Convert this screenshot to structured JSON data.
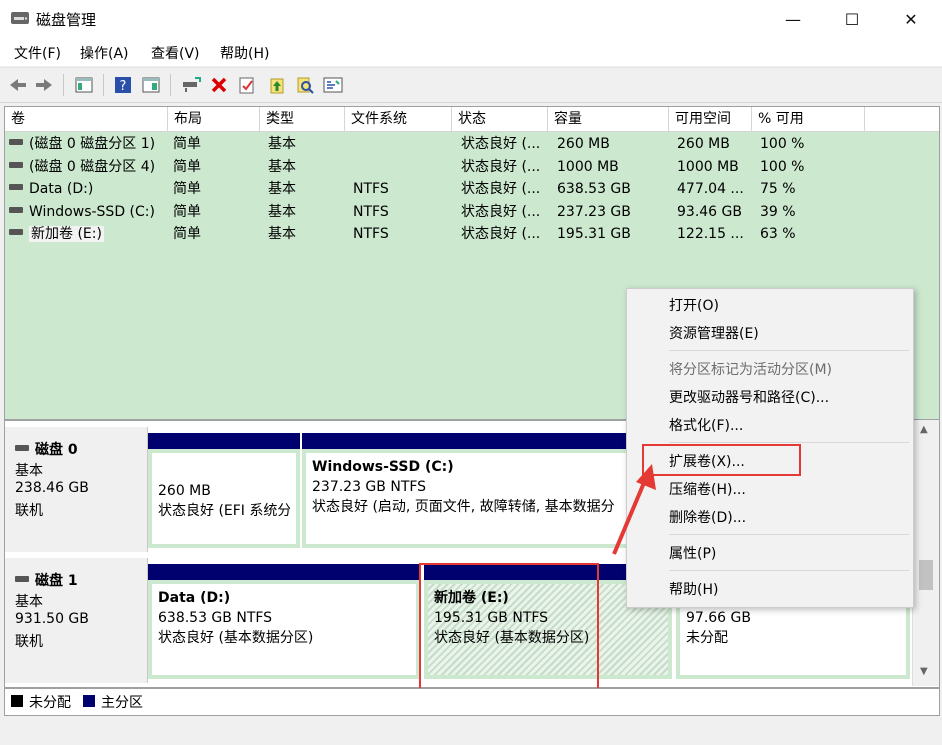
{
  "window": {
    "title": "磁盘管理",
    "minimize": "—",
    "maximize": "☐",
    "close": "✕"
  },
  "menu": [
    "文件(F)",
    "操作(A)",
    "查看(V)",
    "帮助(H)"
  ],
  "toolbar": {
    "icons": [
      "back-icon",
      "forward-icon",
      "console-tree-icon",
      "help-icon",
      "show-pane-icon",
      "connect-icon",
      "delete-icon",
      "check-icon",
      "up-arrow-icon",
      "search-icon",
      "properties-icon"
    ]
  },
  "volume_table": {
    "columns": [
      "卷",
      "布局",
      "类型",
      "文件系统",
      "状态",
      "容量",
      "可用空间",
      "% 可用"
    ],
    "rows": [
      [
        "(磁盘 0 磁盘分区 1)",
        "简单",
        "基本",
        "",
        "状态良好 (...",
        "260 MB",
        "260 MB",
        "100 %"
      ],
      [
        "(磁盘 0 磁盘分区 4)",
        "简单",
        "基本",
        "",
        "状态良好 (...",
        "1000 MB",
        "1000 MB",
        "100 %"
      ],
      [
        "Data (D:)",
        "简单",
        "基本",
        "NTFS",
        "状态良好 (...",
        "638.53 GB",
        "477.04 ...",
        "75 %"
      ],
      [
        "Windows-SSD (C:)",
        "简单",
        "基本",
        "NTFS",
        "状态良好 (...",
        "237.23 GB",
        "93.46 GB",
        "39 %"
      ],
      [
        "新加卷 (E:)",
        "简单",
        "基本",
        "NTFS",
        "状态良好 (...",
        "195.31 GB",
        "122.15 ...",
        "63 %"
      ]
    ]
  },
  "disks": [
    {
      "name": "磁盘 0",
      "type": "基本",
      "size": "238.46 GB",
      "status": "联机",
      "partitions": [
        {
          "title": "",
          "size": "260 MB",
          "status": "状态良好 (EFI 系统分"
        },
        {
          "title": "Windows-SSD  (C:)",
          "size": "237.23 GB NTFS",
          "status": "状态良好 (启动, 页面文件, 故障转储, 基本数据分"
        }
      ]
    },
    {
      "name": "磁盘 1",
      "type": "基本",
      "size": "931.50 GB",
      "status": "联机",
      "partitions": [
        {
          "title": "Data  (D:)",
          "size": "638.53 GB NTFS",
          "status": "状态良好 (基本数据分区)"
        },
        {
          "title": "新加卷  (E:)",
          "size": "195.31 GB NTFS",
          "status": "状态良好 (基本数据分区)"
        },
        {
          "title": "",
          "size": "97.66 GB",
          "status": "未分配"
        }
      ]
    }
  ],
  "legend": {
    "unallocated": "未分配",
    "primary": "主分区"
  },
  "context_menu": {
    "items": [
      "打开(O)",
      "资源管理器(E)",
      "将分区标记为活动分区(M)",
      "更改驱动器号和路径(C)...",
      "格式化(F)...",
      "扩展卷(X)...",
      "压缩卷(H)...",
      "删除卷(D)...",
      "属性(P)",
      "帮助(H)"
    ],
    "disabled": [
      "将分区标记为活动分区(M)"
    ]
  },
  "colors": {
    "partition_bar": "#00006e",
    "volume_list_bg": "#cce8cf",
    "annotation_red": "#e53935"
  }
}
